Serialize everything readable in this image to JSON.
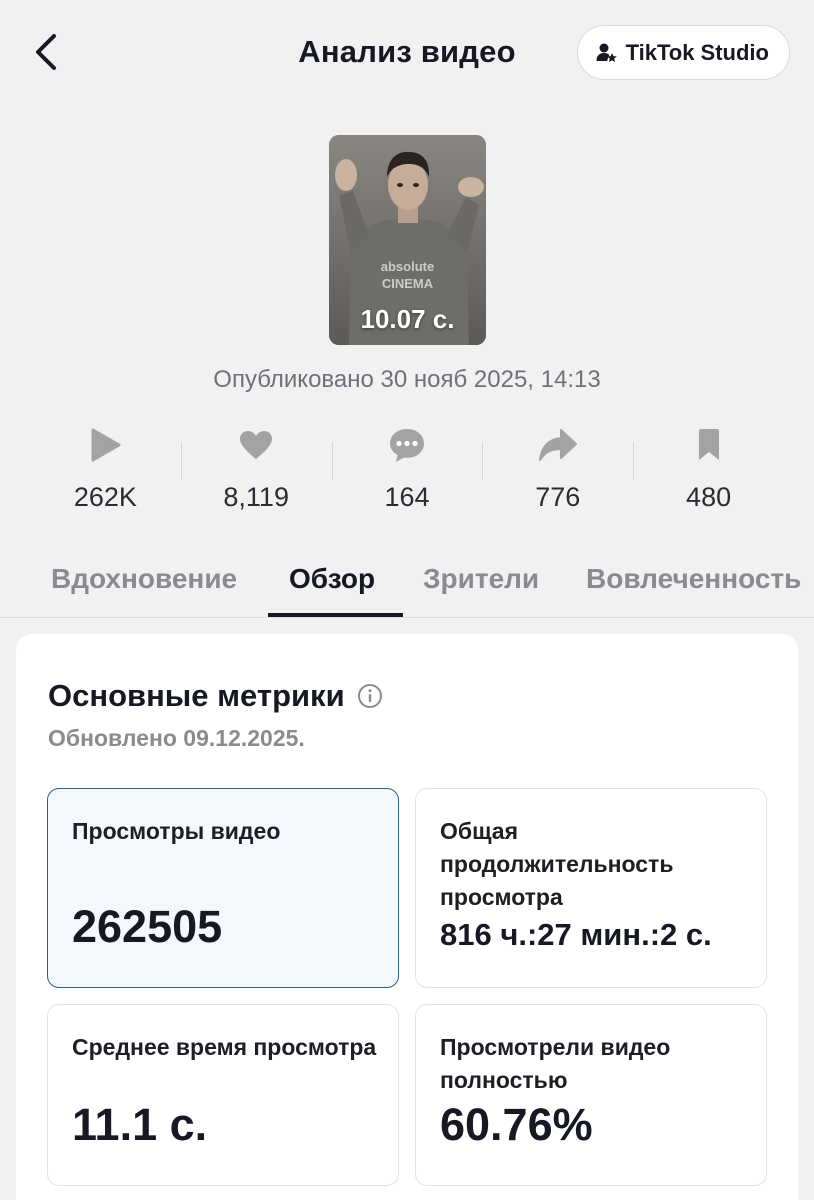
{
  "header": {
    "title": "Анализ видео",
    "studio_button": "TikTok Studio"
  },
  "video": {
    "duration": "10.07 с.",
    "shirt_text_1": "absolute",
    "shirt_text_2": "CINEMA",
    "published": "Опубликовано 30 нояб 2025, 14:13"
  },
  "stats": [
    {
      "icon": "play-icon",
      "value": "262K"
    },
    {
      "icon": "heart-icon",
      "value": "8,119"
    },
    {
      "icon": "comment-icon",
      "value": "164"
    },
    {
      "icon": "share-icon",
      "value": "776"
    },
    {
      "icon": "bookmark-icon",
      "value": "480"
    }
  ],
  "tabs": [
    {
      "label": "Вдохновение"
    },
    {
      "label": "Обзор",
      "active": true
    },
    {
      "label": "Зрители"
    },
    {
      "label": "Вовлеченность"
    }
  ],
  "metrics_card": {
    "title": "Основные метрики",
    "updated": "Обновлено 09.12.2025.",
    "items": [
      {
        "label": "Просмотры видео",
        "value": "262505",
        "selected": true
      },
      {
        "label": "Общая продолжительность просмотра",
        "value": "816 ч.:27 мин.:2 с."
      },
      {
        "label": "Среднее время просмотра",
        "value": "11.1 с."
      },
      {
        "label": "Просмотрели видео полностью",
        "value": "60.76%"
      }
    ]
  },
  "colors": {
    "text_primary": "#161823",
    "text_secondary": "#8a8b91",
    "icon_gray": "#a3a3a6",
    "selected_bg": "#f2f8fc",
    "selected_border": "#2f5f7e"
  }
}
